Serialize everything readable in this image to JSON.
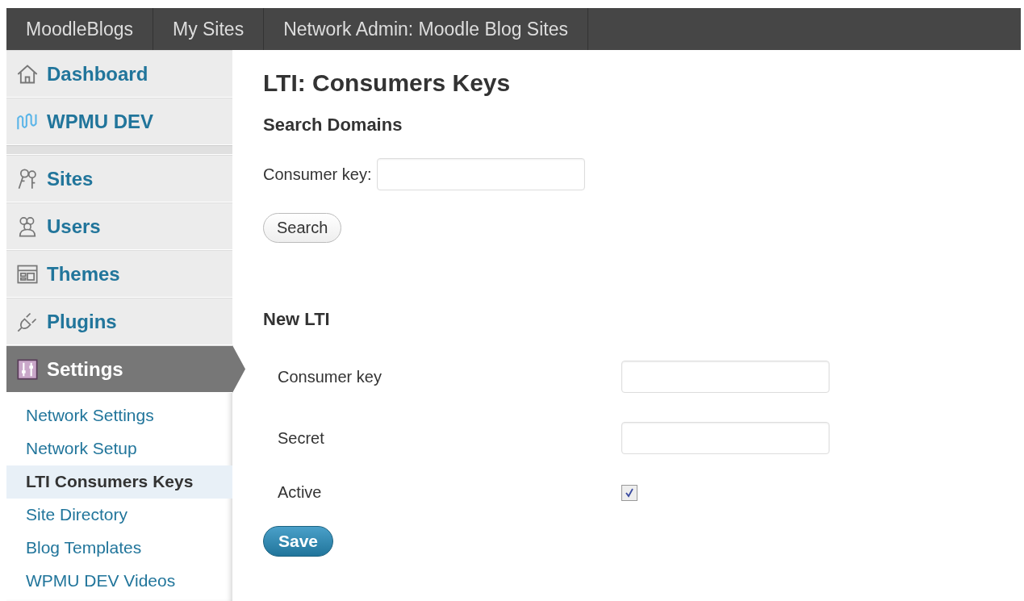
{
  "top_bar": {
    "items": [
      {
        "label": "MoodleBlogs"
      },
      {
        "label": "My Sites"
      },
      {
        "label": "Network Admin: Moodle Blog Sites"
      }
    ]
  },
  "sidebar": {
    "groups": [
      [
        {
          "label": "Dashboard",
          "selected": false
        },
        {
          "label": "WPMU DEV",
          "selected": false
        }
      ],
      [
        {
          "label": "Sites",
          "selected": false
        },
        {
          "label": "Users",
          "selected": false
        },
        {
          "label": "Themes",
          "selected": false
        },
        {
          "label": "Plugins",
          "selected": false
        },
        {
          "label": "Settings",
          "selected": true
        }
      ]
    ],
    "submenu": [
      {
        "label": "Network Settings",
        "selected": false
      },
      {
        "label": "Network Setup",
        "selected": false
      },
      {
        "label": "LTI Consumers Keys",
        "selected": true
      },
      {
        "label": "Site Directory",
        "selected": false
      },
      {
        "label": "Blog Templates",
        "selected": false
      },
      {
        "label": "WPMU DEV Videos",
        "selected": false
      }
    ]
  },
  "page_title": "LTI: Consumers Keys",
  "search": {
    "heading": "Search Domains",
    "label": "Consumer key:",
    "button": "Search"
  },
  "new_lti": {
    "heading": "New LTI",
    "rows": [
      {
        "kind": "text",
        "label": "Consumer key"
      },
      {
        "kind": "text",
        "label": "Secret"
      },
      {
        "kind": "checkbox",
        "label": "Active",
        "checked": true
      }
    ],
    "button": "Save"
  }
}
